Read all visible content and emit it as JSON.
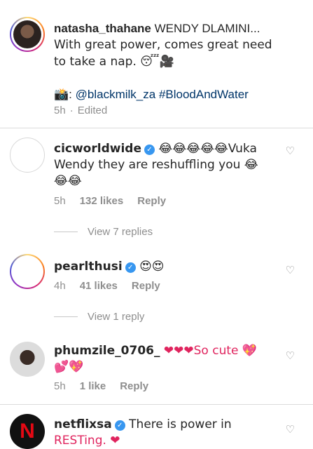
{
  "post": {
    "username": "natasha_thahane",
    "caption_lines": [
      "WENDY DLAMINI...",
      "With great power, comes great need",
      "to take a nap. 😴🎥"
    ],
    "credit_icon": "📸",
    "credit_sep": ": ",
    "credit_user": "@blackmilk_za",
    "credit_tag": "#BloodAndWater",
    "time": "5h",
    "edited": "Edited"
  },
  "comments": [
    {
      "username": "cicworldwide",
      "verified": true,
      "text_line1": "😂😂😂😂😂Vuka",
      "text_line2": "Wendy they are reshuffling you 😂",
      "text_line3": "😂😂",
      "time": "5h",
      "likes": "132 likes",
      "reply": "Reply",
      "view_replies": "View 7 replies"
    },
    {
      "username": "pearlthusi",
      "verified": true,
      "text_line1": "😍😍",
      "time": "4h",
      "likes": "41 likes",
      "reply": "Reply",
      "view_replies": "View 1 reply"
    },
    {
      "username": "phumzile_0706_",
      "verified": false,
      "text_line1": "❤❤❤So cute 💖",
      "text_line2": "💕💖",
      "time": "5h",
      "likes": "1 like",
      "reply": "Reply"
    },
    {
      "username": "netflixsa",
      "verified": true,
      "text_line1": "There is power in",
      "text_line2": "RESTing. ❤",
      "avatar_letter": "N"
    }
  ],
  "icons": {
    "heart": "heart-outline-icon",
    "verified": "verified-badge-icon"
  },
  "colors": {
    "link": "#003569",
    "verified": "#3897f0",
    "meta": "#8e8e8e"
  }
}
